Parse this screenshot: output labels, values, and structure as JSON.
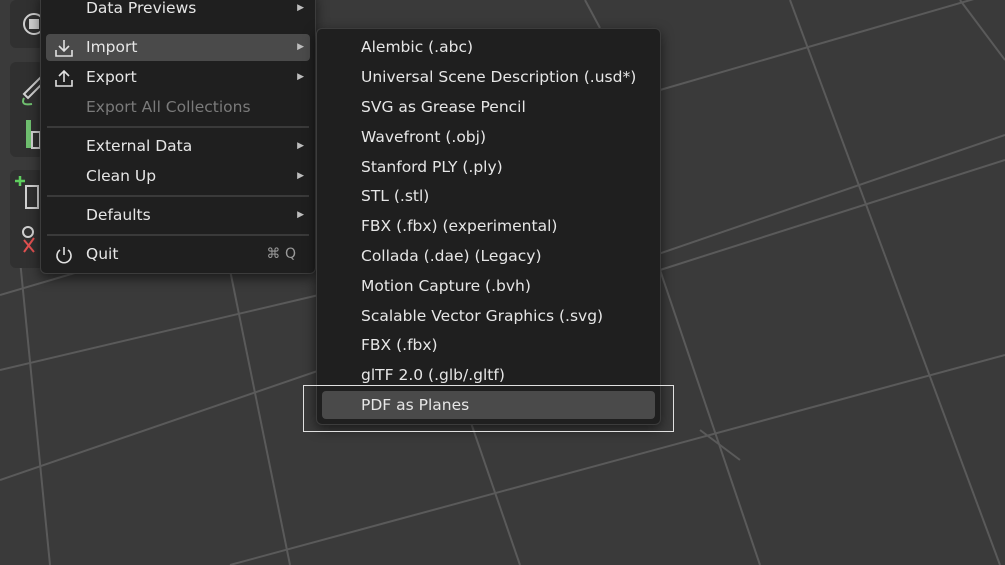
{
  "file_menu": {
    "items": [
      {
        "label": "Data Previews",
        "has_submenu": true
      },
      {
        "label": "Import",
        "has_submenu": true,
        "active": true,
        "icon": "import-icon"
      },
      {
        "label": "Export",
        "has_submenu": true,
        "icon": "export-icon"
      },
      {
        "label": "Export All Collections",
        "disabled": true
      },
      {
        "label": "External Data",
        "has_submenu": true
      },
      {
        "label": "Clean Up",
        "has_submenu": true
      },
      {
        "label": "Defaults",
        "has_submenu": true
      },
      {
        "label": "Quit",
        "shortcut": "⌘ Q",
        "icon": "power-icon"
      }
    ]
  },
  "import_submenu": {
    "items": [
      "Alembic (.abc)",
      "Universal Scene Description (.usd*)",
      "SVG as Grease Pencil",
      "Wavefront (.obj)",
      "Stanford PLY (.ply)",
      "STL (.stl)",
      "FBX (.fbx) (experimental)",
      "Collada (.dae) (Legacy)",
      "Motion Capture (.bvh)",
      "Scalable Vector Graphics (.svg)",
      "FBX (.fbx)",
      "glTF 2.0 (.glb/.gltf)",
      "PDF as Planes"
    ],
    "highlighted": "PDF as Planes"
  },
  "colors": {
    "viewport_bg": "#3a3a3a",
    "grid_line": "#5a5a5a",
    "menu_bg": "#1f1f1f",
    "active_item": "#4a4a4a"
  }
}
